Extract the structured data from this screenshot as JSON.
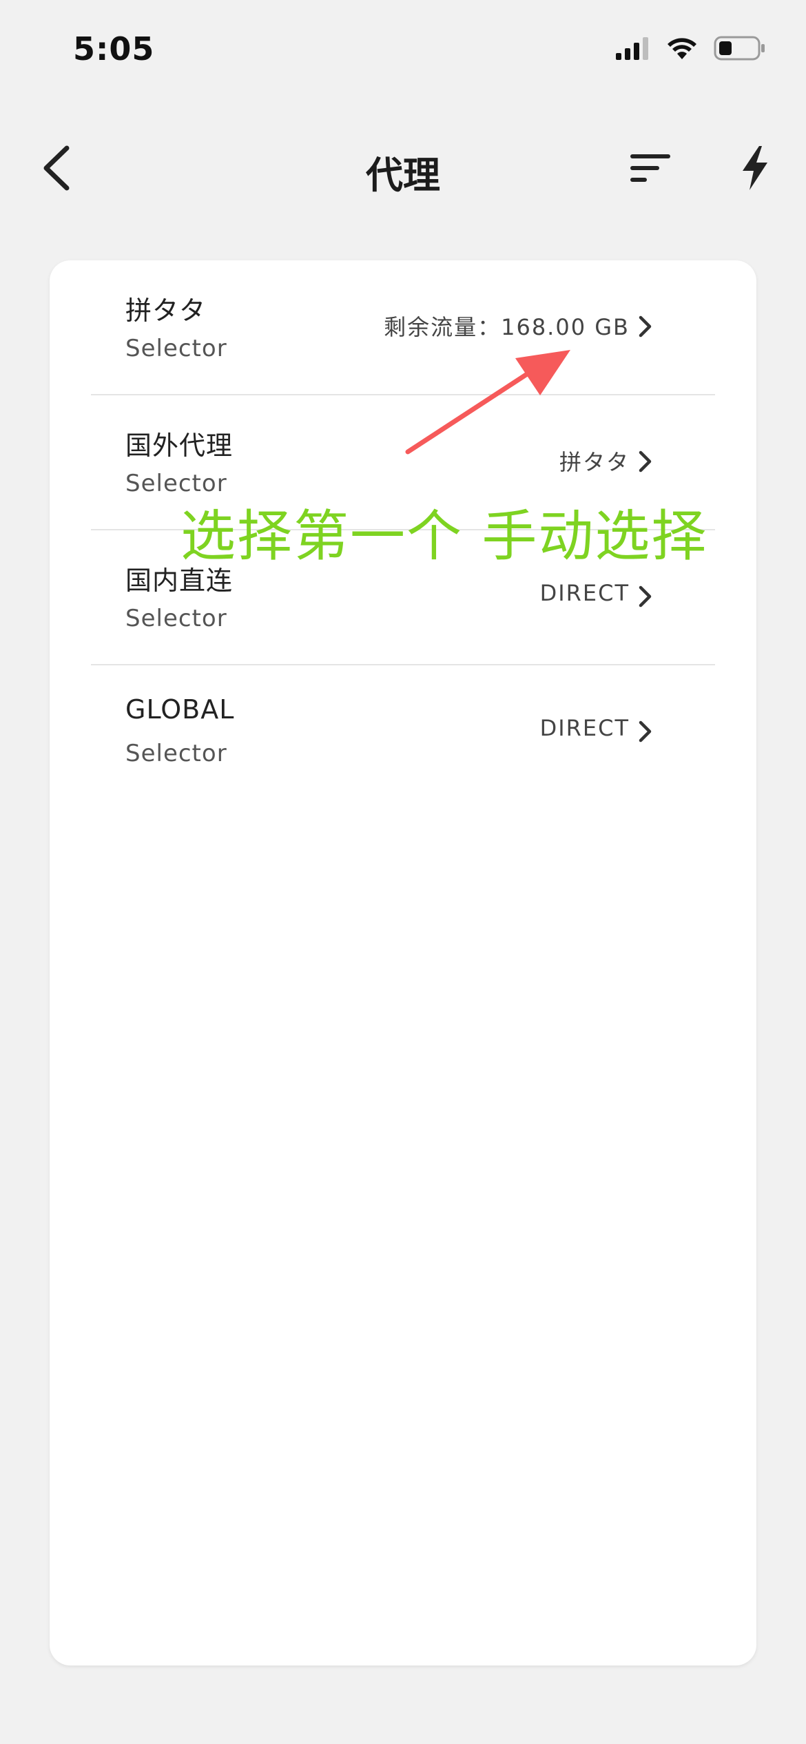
{
  "status_bar": {
    "time": "5:05",
    "icons": [
      "signal-icon",
      "wifi-icon",
      "battery-icon"
    ]
  },
  "header": {
    "title": "代理",
    "back_icon": "chevron-left-icon",
    "sort_icon": "sort-icon",
    "speed_icon": "lightning-icon"
  },
  "proxy_groups": [
    {
      "name": "拼タタ",
      "type": "Selector",
      "value": "剩余流量：168.00 GB"
    },
    {
      "name": "国外代理",
      "type": "Selector",
      "value": "拼タタ"
    },
    {
      "name": "国内直连",
      "type": "Selector",
      "value": "DIRECT"
    },
    {
      "name": "GLOBAL",
      "type": "Selector",
      "value": "DIRECT"
    }
  ],
  "annotation": {
    "text": "选择第一个 手动选择",
    "text_color": "#7ed321",
    "arrow_color": "#f65a5a"
  },
  "colors": {
    "background": "#f1f1f1",
    "card": "#ffffff",
    "divider": "#e4e4e4"
  }
}
